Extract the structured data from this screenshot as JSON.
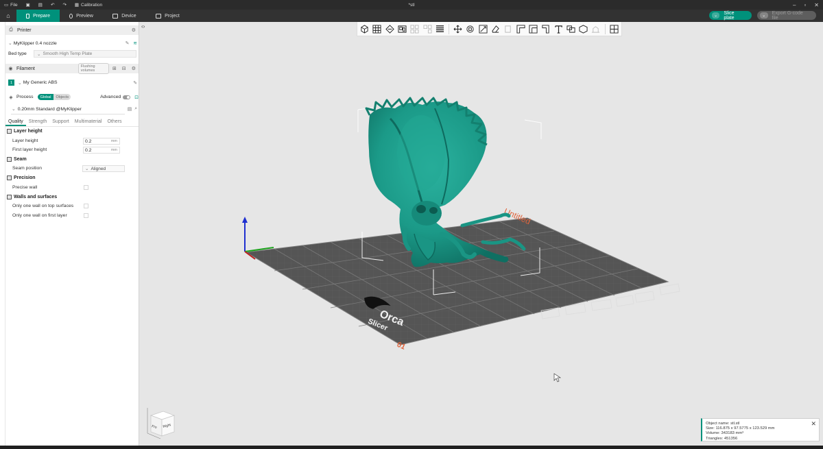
{
  "titlebar": {
    "file_label": "File",
    "calibration_label": "Calibration",
    "window_title": "*stl"
  },
  "tabs": [
    {
      "label": "Prepare",
      "icon": "cube-icon",
      "active": true
    },
    {
      "label": "Preview",
      "icon": "layers-icon",
      "active": false
    },
    {
      "label": "Device",
      "icon": "monitor-icon",
      "active": false
    },
    {
      "label": "Project",
      "icon": "project-icon",
      "active": false
    }
  ],
  "actions": {
    "slice_label": "Slice plate",
    "export_label": "Export G-code file"
  },
  "printer": {
    "header": "Printer",
    "name": "MyKlipper 0.4 nozzle",
    "bed_label": "Bed type",
    "bed_value": "Smooth High Temp Plate"
  },
  "filament": {
    "header": "Filament",
    "flushing_label": "Flushing volumes",
    "slot_number": "1",
    "name": "My Generic ABS"
  },
  "process": {
    "header": "Process",
    "global_label": "Global",
    "objects_label": "Objects",
    "advanced_label": "Advanced",
    "preset": "0.20mm Standard @MyKlipper"
  },
  "process_tabs": [
    "Quality",
    "Strength",
    "Support",
    "Multimaterial",
    "Others"
  ],
  "quality": {
    "layer_height_group": "Layer height",
    "layer_height_label": "Layer height",
    "layer_height_value": "0.2",
    "first_layer_label": "First layer height",
    "first_layer_value": "0.2",
    "unit": "mm",
    "seam_group": "Seam",
    "seam_position_label": "Seam position",
    "seam_position_value": "Aligned",
    "precision_group": "Precision",
    "precise_wall_label": "Precise wall",
    "walls_group": "Walls and surfaces",
    "one_wall_top_label": "Only one wall on top surfaces",
    "one_wall_first_label": "Only one wall on first layer"
  },
  "plate": {
    "name_label": "Untitled",
    "number_label": "01",
    "logo_line1": "Orca",
    "logo_line2": "Slicer"
  },
  "navcube": {
    "front_label": "Fro",
    "right_label": "Right"
  },
  "object_info": {
    "name": "Object name: stl.stl",
    "size": "Size: 116.875 x 97.5775 x 123.529 mm",
    "volume": "Volume: 343183 mm³",
    "triangles": "Triangles: 451356"
  },
  "colors": {
    "accent": "#00917b",
    "model": "#1e9a8a",
    "plate_dark": "#555555",
    "plate_label": "#e0643c"
  }
}
